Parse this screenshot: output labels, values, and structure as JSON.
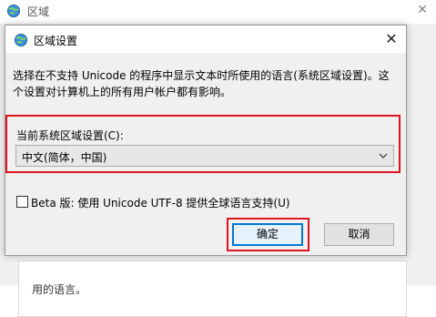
{
  "background_window": {
    "title": "区域",
    "close_glyph": "✕",
    "partial_text": "用的语言。"
  },
  "dialog": {
    "title": "区域设置",
    "close_glyph": "✕",
    "description": "选择在不支持 Unicode 的程序中显示文本时所使用的语言(系统区域设置)。这个设置对计算机上的所有用户帐户都有影响。",
    "locale_label": "当前系统区域设置(C):",
    "locale_value": "中文(简体，中国)",
    "beta_label": "Beta 版: 使用 Unicode UTF-8 提供全球语言支持(U)",
    "beta_checked": false,
    "ok_label": "确定",
    "cancel_label": "取消"
  },
  "colors": {
    "highlight_red": "#e0141e",
    "focus_blue": "#0078d7"
  },
  "icons": {
    "window_icon": "globe-icon",
    "close_icon": "close-icon",
    "dropdown_icon": "chevron-down-icon"
  }
}
